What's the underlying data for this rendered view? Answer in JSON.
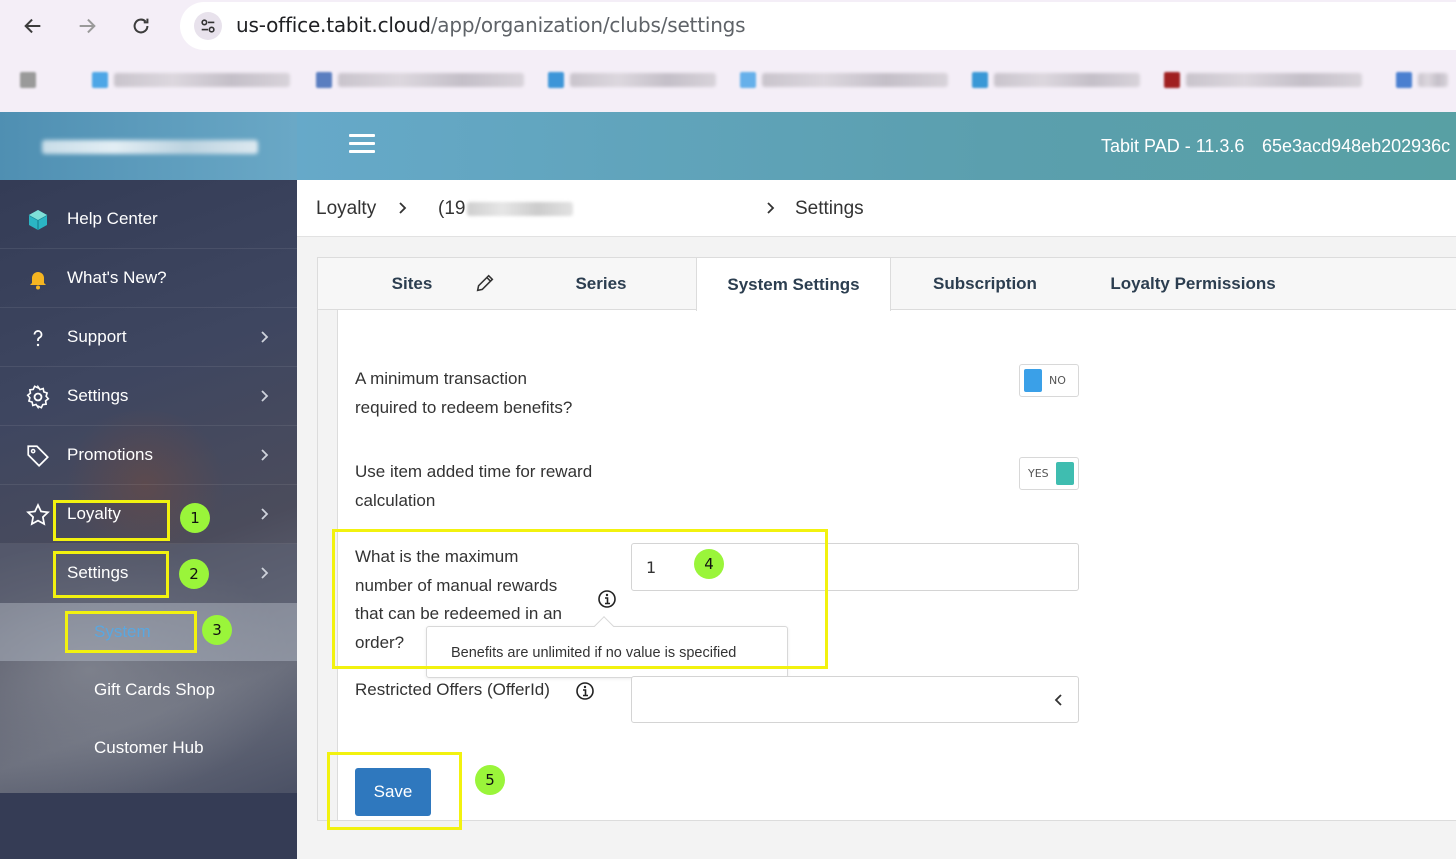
{
  "browser": {
    "url_host": "us-office.tabit.cloud",
    "url_path": "/app/organization/clubs/settings"
  },
  "header": {
    "version": "Tabit PAD - 11.3.6",
    "id": "65e3acd948eb202936c"
  },
  "sidebar": {
    "items": [
      {
        "label": "Help Center",
        "icon": "cube-icon"
      },
      {
        "label": "What's New?",
        "icon": "bell-icon"
      },
      {
        "label": "Support",
        "icon": "question-icon"
      },
      {
        "label": "Settings",
        "icon": "gear-icon"
      },
      {
        "label": "Promotions",
        "icon": "tag-icon"
      },
      {
        "label": "Loyalty",
        "icon": "star-icon"
      }
    ],
    "sub_settings": "Settings",
    "sub_items": [
      "System",
      "Gift Cards Shop",
      "Customer Hub"
    ]
  },
  "breadcrumb": {
    "first": "Loyalty",
    "second": "(19",
    "third": "Settings"
  },
  "tabs": [
    "Sites",
    "Series",
    "System Settings",
    "Subscription",
    "Loyalty Permissions"
  ],
  "fields": {
    "min_transaction": {
      "label_line1": "A minimum transaction",
      "label_line2": "required to redeem benefits?",
      "toggle_text": "NO"
    },
    "item_added_time": {
      "label_line1": "Use item added time for reward",
      "label_line2": "calculation",
      "toggle_text": "YES"
    },
    "max_manual_rewards": {
      "label_line1": "What is the maximum",
      "label_line2": "number of manual rewards",
      "label_line3": "that can be redeemed in an",
      "label_line4": "order?",
      "value": "1",
      "tooltip": "Benefits are unlimited if no value is specified"
    },
    "restricted_offers": {
      "label": "Restricted Offers (OfferId)"
    }
  },
  "save_label": "Save",
  "annotations": [
    "1",
    "2",
    "3",
    "4",
    "5"
  ],
  "colors": {
    "accent_blue": "#2f78be",
    "toggle_no": "#3aa0e8",
    "toggle_yes": "#3fbdb0",
    "highlight": "#f2f20f",
    "badge": "#9af53a"
  }
}
